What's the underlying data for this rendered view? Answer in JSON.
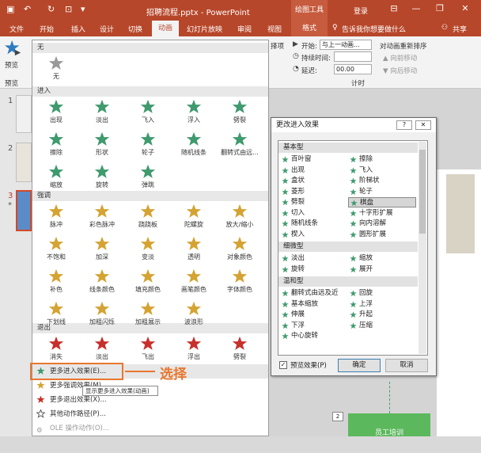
{
  "window": {
    "title": "招聘流程.pptx - PowerPoint",
    "drawing_tools": "绘图工具",
    "login": "登录",
    "minimize": "—",
    "restore": "❐",
    "close": "✕"
  },
  "tabs": [
    "文件",
    "开始",
    "插入",
    "设计",
    "切换",
    "动画",
    "幻灯片放映",
    "审阅",
    "视图"
  ],
  "tab_format": "格式",
  "tell_me": "告诉我你想要做什么",
  "share": "共享",
  "ribbon": {
    "preview_label": "预览",
    "preview_group": "预览",
    "effect_options_tail": "择项",
    "start_label": "开始:",
    "start_value": "与上一动画...",
    "duration_label": "持续时间:",
    "duration_value": "",
    "delay_label": "延迟:",
    "delay_value": "00.00",
    "reorder_title": "对动画重新排序",
    "move_earlier": "向前移动",
    "move_later": "向后移动",
    "timing_group": "计时"
  },
  "thumbs": {
    "n1": "1",
    "n2": "2",
    "n3": "3",
    "star": "*"
  },
  "gallery": {
    "none_section": "无",
    "none_item": "无",
    "entrance_section": "进入",
    "entrance": [
      "出现",
      "淡出",
      "飞入",
      "浮入",
      "劈裂",
      "擦除",
      "形状",
      "轮子",
      "随机线条",
      "翻转式由远...",
      "缩放",
      "旋转",
      "弹跳"
    ],
    "emphasis_section": "强调",
    "emphasis": [
      "脉冲",
      "彩色脉冲",
      "跷跷板",
      "陀螺旋",
      "放大/缩小",
      "不饱和",
      "加深",
      "变淡",
      "透明",
      "对象颜色",
      "补色",
      "线条颜色",
      "填充颜色",
      "画笔颜色",
      "字体颜色",
      "下划线",
      "加粗闪烁",
      "加粗展示",
      "波浪形"
    ],
    "exit_section": "退出",
    "exit": [
      "消失",
      "淡出",
      "飞出",
      "浮出",
      "劈裂"
    ],
    "menu": [
      "更多进入效果(E)...",
      "更多强调效果(M)...",
      "更多退出效果(X)...",
      "其他动作路径(P)...",
      "OLE 操作动作(O)..."
    ],
    "tooltip": "显示更多进入效果(动画)",
    "callout": "选择"
  },
  "colors": {
    "accent": "#b7472a",
    "star_entrance": "#3f9a6d",
    "star_emphasis": "#d4a332",
    "star_exit": "#c8302c",
    "callout": "#e8772e"
  },
  "dialog": {
    "title": "更改进入效果",
    "help": "?",
    "close": "✕",
    "basic": "基本型",
    "basic_items": [
      "百叶窗",
      "擦除",
      "出现",
      "飞入",
      "盒状",
      "阶梯状",
      "菱形",
      "轮子",
      "劈裂",
      "棋盘",
      "切入",
      "十字形扩展",
      "随机线条",
      "向内溶解",
      "楔入",
      "圆形扩展"
    ],
    "subtle": "细微型",
    "subtle_items": [
      "淡出",
      "缩放",
      "旋转",
      "展开"
    ],
    "moderate": "温和型",
    "moderate_items": [
      "翻转式由远及近",
      "回旋",
      "基本缩放",
      "上浮",
      "伸展",
      "升起",
      "下浮",
      "压缩",
      "中心旋转"
    ],
    "selected": "棋盘",
    "preview_check": "预览效果(P)",
    "ok": "确定",
    "cancel": "取消"
  },
  "slide": {
    "box_label": "员工培训",
    "number": "2"
  }
}
